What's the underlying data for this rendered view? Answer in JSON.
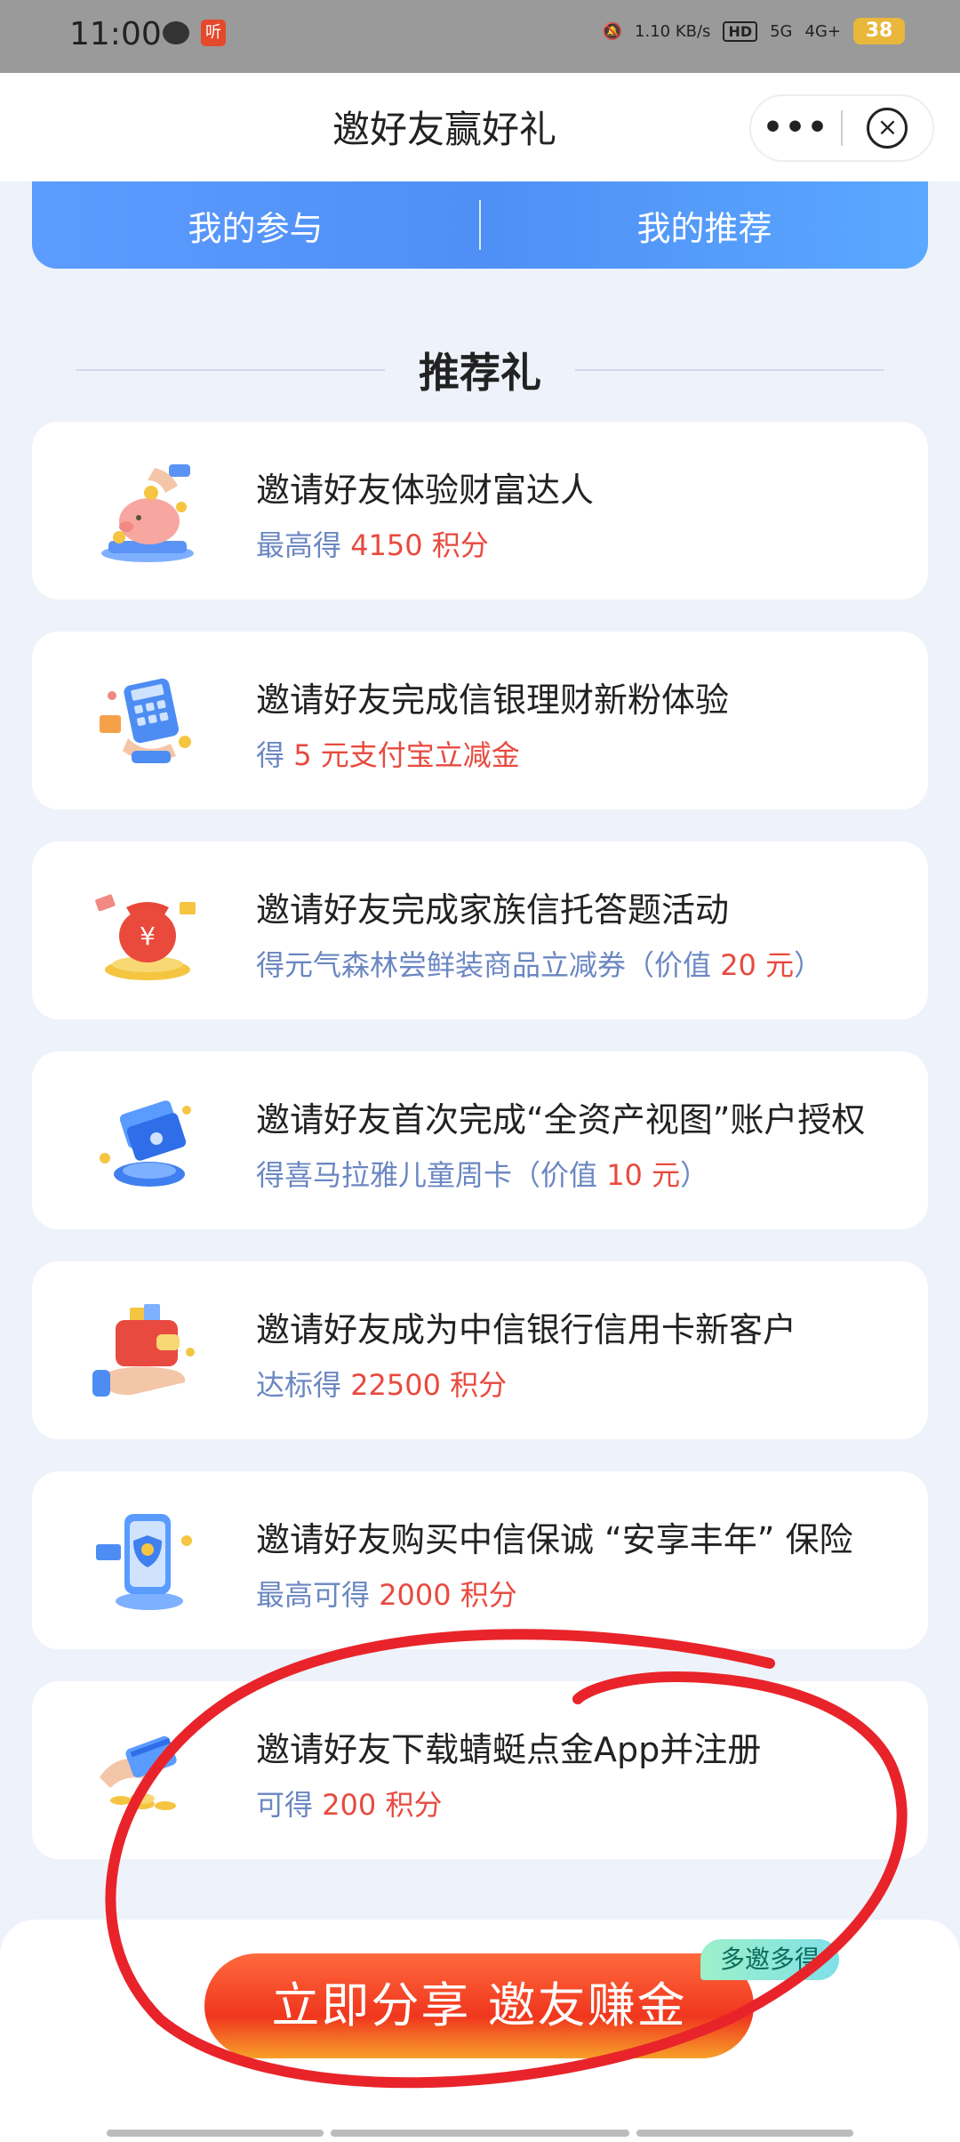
{
  "status": {
    "time": "11:00",
    "app_badge": "听",
    "net_speed": "1.10 KB/s",
    "hd": "HD",
    "net1": "5G",
    "net2": "4G+",
    "battery": "38"
  },
  "nav": {
    "title": "邀好友赢好礼",
    "more": "•••",
    "close": "×"
  },
  "tabs": [
    {
      "label": "我的参与"
    },
    {
      "label": "我的推荐"
    }
  ],
  "section_title": "推荐礼",
  "cards": [
    {
      "title": "邀请好友体验财富达人",
      "sub_pre": "最高得 ",
      "sub_hl": "4150 积分",
      "sub_post": ""
    },
    {
      "title": "邀请好友完成信银理财新粉体验",
      "sub_pre": "得 ",
      "sub_hl": "5 元支付宝立减金",
      "sub_post": ""
    },
    {
      "title": "邀请好友完成家族信托答题活动",
      "sub_pre": "得元气森林尝鲜装商品立减券（价值 ",
      "sub_hl": "20 元",
      "sub_post": "）"
    },
    {
      "title": "邀请好友首次完成“全资产视图”账户授权",
      "sub_pre": "得喜马拉雅儿童周卡（价值 ",
      "sub_hl": "10 元",
      "sub_post": "）"
    },
    {
      "title": "邀请好友成为中信银行信用卡新客户",
      "sub_pre": "达标得 ",
      "sub_hl": "22500 积分",
      "sub_post": ""
    },
    {
      "title": "邀请好友购买中信保诚 “安享丰年” 保险",
      "sub_pre": "最高可得 ",
      "sub_hl": "2000 积分",
      "sub_post": ""
    },
    {
      "title": "邀请好友下载蜻蜓点金App并注册",
      "sub_pre": "可得 ",
      "sub_hl": "200 积分",
      "sub_post": ""
    }
  ],
  "share_button": "立即分享 邀友赚金",
  "badge": "多邀多得",
  "colors": {
    "accent_blue": "#4f8ff6",
    "highlight_red": "#e84a3f",
    "sub_blue": "#6b87c2",
    "annotation_red": "#e8242a"
  }
}
